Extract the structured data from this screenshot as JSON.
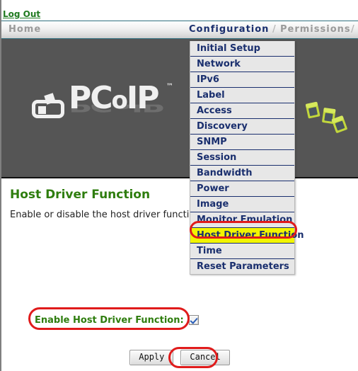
{
  "header": {
    "logout_label": "Log Out"
  },
  "nav": {
    "items": [
      {
        "label": "Home",
        "state": "inactive"
      },
      {
        "label": "Configuration",
        "state": "active"
      },
      {
        "label": "Permissions",
        "state": "inactive"
      }
    ],
    "separator": "/",
    "separator2": "/"
  },
  "banner": {
    "logo_text_1": "PC",
    "logo_text_o": "o",
    "logo_text_2": "IP",
    "trademark": "™",
    "logo_alt": "PCoIP"
  },
  "menu": {
    "items": [
      {
        "label": "Initial Setup",
        "highlighted": false
      },
      {
        "label": "Network",
        "highlighted": false
      },
      {
        "label": "IPv6",
        "highlighted": false
      },
      {
        "label": "Label",
        "highlighted": false
      },
      {
        "label": "Access",
        "highlighted": false
      },
      {
        "label": "Discovery",
        "highlighted": false
      },
      {
        "label": "SNMP",
        "highlighted": false
      },
      {
        "label": "Session",
        "highlighted": false
      },
      {
        "label": "Bandwidth",
        "highlighted": false
      },
      {
        "label": "Power",
        "highlighted": false
      },
      {
        "label": "Image",
        "highlighted": false
      },
      {
        "label": "Monitor Emulation",
        "highlighted": false
      },
      {
        "label": "Host Driver Function",
        "highlighted": true
      },
      {
        "label": "Time",
        "highlighted": false
      },
      {
        "label": "Reset Parameters",
        "highlighted": false
      }
    ]
  },
  "main": {
    "title": "Host Driver Function",
    "description": "Enable or disable the host driver function",
    "enable_label": "Enable Host Driver Function:",
    "enable_checked": true,
    "apply_label": "Apply",
    "cancel_label": "Cancel"
  },
  "colors": {
    "accent_green": "#2e7d0e",
    "nav_active": "#1a2f6e",
    "highlight_yellow": "#f2f500",
    "annotation_red": "#e01b1b",
    "banner_gray": "#555555",
    "cube_green": "#c2d73c"
  }
}
